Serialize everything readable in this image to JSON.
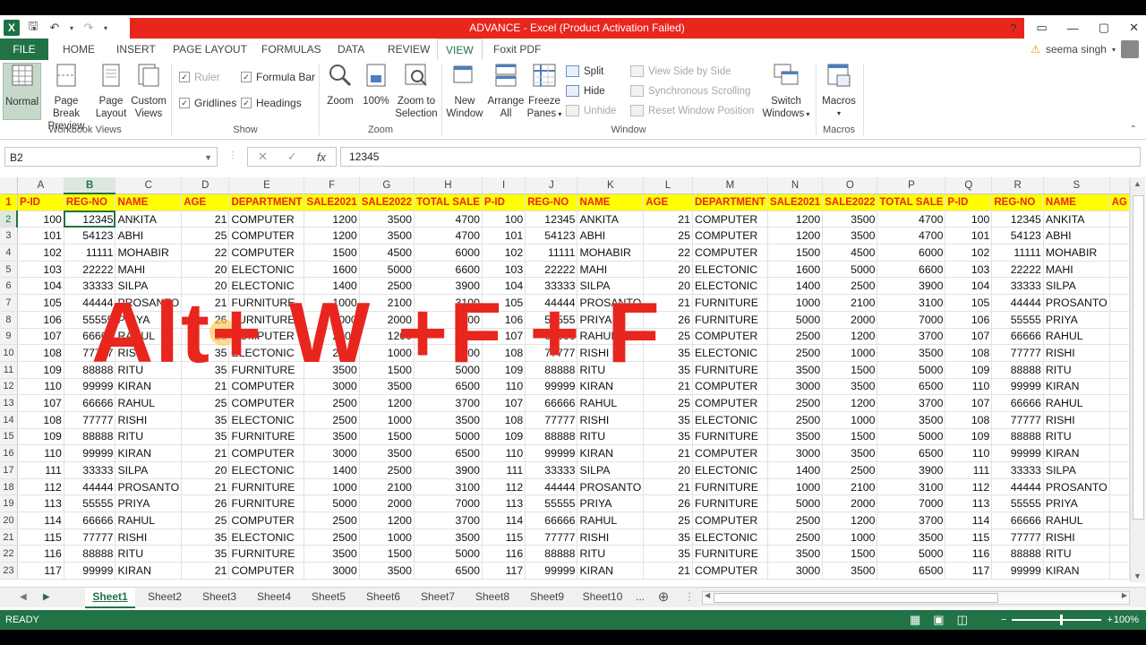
{
  "app": {
    "title": "ADVANCE - Excel (Product Activation Failed)",
    "logo_letter": "X",
    "user_name": "seema singh",
    "help": "?",
    "window_controls": [
      "▭",
      "—",
      "▢",
      "✕"
    ]
  },
  "qat": {
    "save_icon": "save-icon",
    "undo_icon": "undo-icon",
    "redo_icon": "redo-icon"
  },
  "tabs": [
    "FILE",
    "HOME",
    "INSERT",
    "PAGE LAYOUT",
    "FORMULAS",
    "DATA",
    "REVIEW",
    "VIEW",
    "Foxit PDF"
  ],
  "active_tab": "VIEW",
  "ribbon": {
    "workbook_views": {
      "label": "Workbook Views",
      "normal": "Normal",
      "page_break_1": "Page Break",
      "page_break_2": "Preview",
      "page_layout_1": "Page",
      "page_layout_2": "Layout",
      "custom_1": "Custom",
      "custom_2": "Views"
    },
    "show": {
      "label": "Show",
      "ruler": "Ruler",
      "formula_bar": "Formula Bar",
      "gridlines": "Gridlines",
      "headings": "Headings"
    },
    "zoom": {
      "label": "Zoom",
      "zoom": "Zoom",
      "hundred": "100%",
      "zoom_sel_1": "Zoom to",
      "zoom_sel_2": "Selection"
    },
    "window": {
      "label": "Window",
      "new_window_1": "New",
      "new_window_2": "Window",
      "arrange_1": "Arrange",
      "arrange_2": "All",
      "freeze_1": "Freeze",
      "freeze_2": "Panes",
      "split": "Split",
      "hide": "Hide",
      "unhide": "Unhide",
      "view_side": "View Side by Side",
      "sync_scroll": "Synchronous Scrolling",
      "reset_pos": "Reset Window Position",
      "switch_1": "Switch",
      "switch_2": "Windows"
    },
    "macros": {
      "label": "Macros",
      "macros": "Macros"
    }
  },
  "formula_bar": {
    "name_box": "B2",
    "cancel": "✕",
    "enter": "✓",
    "fx": "fx",
    "value": "12345"
  },
  "columns": [
    "A",
    "B",
    "C",
    "D",
    "E",
    "F",
    "G",
    "H",
    "I",
    "J",
    "K",
    "L",
    "M",
    "N",
    "O",
    "P",
    "Q",
    "R",
    "S",
    ""
  ],
  "selected_column": "B",
  "header_row": [
    "P-ID",
    "REG-NO",
    "NAME",
    "AGE",
    "DEPARTMENT",
    "SALE2021",
    "SALE2022",
    "TOTAL SALE",
    "P-ID",
    "REG-NO",
    "NAME",
    "AGE",
    "DEPARTMENT",
    "SALE2021",
    "SALE2022",
    "TOTAL SALE",
    "P-ID",
    "REG-NO",
    "NAME",
    "AG"
  ],
  "rows": [
    {
      "n": "2",
      "c": [
        "100",
        "12345",
        "ANKITA",
        "21",
        "COMPUTER",
        "1200",
        "3500",
        "4700",
        "100",
        "12345",
        "ANKITA",
        "21",
        "COMPUTER",
        "1200",
        "3500",
        "4700",
        "100",
        "12345",
        "ANKITA",
        ""
      ]
    },
    {
      "n": "3",
      "c": [
        "101",
        "54123",
        "ABHI",
        "25",
        "COMPUTER",
        "1200",
        "3500",
        "4700",
        "101",
        "54123",
        "ABHI",
        "25",
        "COMPUTER",
        "1200",
        "3500",
        "4700",
        "101",
        "54123",
        "ABHI",
        ""
      ]
    },
    {
      "n": "4",
      "c": [
        "102",
        "11111",
        "MOHABIR",
        "22",
        "COMPUTER",
        "1500",
        "4500",
        "6000",
        "102",
        "11111",
        "MOHABIR",
        "22",
        "COMPUTER",
        "1500",
        "4500",
        "6000",
        "102",
        "11111",
        "MOHABIR",
        ""
      ]
    },
    {
      "n": "5",
      "c": [
        "103",
        "22222",
        "MAHI",
        "20",
        "ELECTONIC",
        "1600",
        "5000",
        "6600",
        "103",
        "22222",
        "MAHI",
        "20",
        "ELECTONIC",
        "1600",
        "5000",
        "6600",
        "103",
        "22222",
        "MAHI",
        ""
      ]
    },
    {
      "n": "6",
      "c": [
        "104",
        "33333",
        "SILPA",
        "20",
        "ELECTONIC",
        "1400",
        "2500",
        "3900",
        "104",
        "33333",
        "SILPA",
        "20",
        "ELECTONIC",
        "1400",
        "2500",
        "3900",
        "104",
        "33333",
        "SILPA",
        ""
      ]
    },
    {
      "n": "7",
      "c": [
        "105",
        "44444",
        "PROSANTO",
        "21",
        "FURNITURE",
        "1000",
        "2100",
        "3100",
        "105",
        "44444",
        "PROSANTO",
        "21",
        "FURNITURE",
        "1000",
        "2100",
        "3100",
        "105",
        "44444",
        "PROSANTO",
        ""
      ]
    },
    {
      "n": "8",
      "c": [
        "106",
        "55555",
        "PRIYA",
        "26",
        "FURNITURE",
        "5000",
        "2000",
        "7000",
        "106",
        "55555",
        "PRIYA",
        "26",
        "FURNITURE",
        "5000",
        "2000",
        "7000",
        "106",
        "55555",
        "PRIYA",
        ""
      ]
    },
    {
      "n": "9",
      "c": [
        "107",
        "66666",
        "RAHUL",
        "25",
        "COMPUTER",
        "2500",
        "1200",
        "3700",
        "107",
        "66666",
        "RAHUL",
        "25",
        "COMPUTER",
        "2500",
        "1200",
        "3700",
        "107",
        "66666",
        "RAHUL",
        ""
      ]
    },
    {
      "n": "10",
      "c": [
        "108",
        "77777",
        "RISHI",
        "35",
        "ELECTONIC",
        "2500",
        "1000",
        "3500",
        "108",
        "77777",
        "RISHI",
        "35",
        "ELECTONIC",
        "2500",
        "1000",
        "3500",
        "108",
        "77777",
        "RISHI",
        ""
      ]
    },
    {
      "n": "11",
      "c": [
        "109",
        "88888",
        "RITU",
        "35",
        "FURNITURE",
        "3500",
        "1500",
        "5000",
        "109",
        "88888",
        "RITU",
        "35",
        "FURNITURE",
        "3500",
        "1500",
        "5000",
        "109",
        "88888",
        "RITU",
        ""
      ]
    },
    {
      "n": "12",
      "c": [
        "110",
        "99999",
        "KIRAN",
        "21",
        "COMPUTER",
        "3000",
        "3500",
        "6500",
        "110",
        "99999",
        "KIRAN",
        "21",
        "COMPUTER",
        "3000",
        "3500",
        "6500",
        "110",
        "99999",
        "KIRAN",
        ""
      ]
    },
    {
      "n": "13",
      "c": [
        "107",
        "66666",
        "RAHUL",
        "25",
        "COMPUTER",
        "2500",
        "1200",
        "3700",
        "107",
        "66666",
        "RAHUL",
        "25",
        "COMPUTER",
        "2500",
        "1200",
        "3700",
        "107",
        "66666",
        "RAHUL",
        ""
      ]
    },
    {
      "n": "14",
      "c": [
        "108",
        "77777",
        "RISHI",
        "35",
        "ELECTONIC",
        "2500",
        "1000",
        "3500",
        "108",
        "77777",
        "RISHI",
        "35",
        "ELECTONIC",
        "2500",
        "1000",
        "3500",
        "108",
        "77777",
        "RISHI",
        ""
      ]
    },
    {
      "n": "15",
      "c": [
        "109",
        "88888",
        "RITU",
        "35",
        "FURNITURE",
        "3500",
        "1500",
        "5000",
        "109",
        "88888",
        "RITU",
        "35",
        "FURNITURE",
        "3500",
        "1500",
        "5000",
        "109",
        "88888",
        "RITU",
        ""
      ]
    },
    {
      "n": "16",
      "c": [
        "110",
        "99999",
        "KIRAN",
        "21",
        "COMPUTER",
        "3000",
        "3500",
        "6500",
        "110",
        "99999",
        "KIRAN",
        "21",
        "COMPUTER",
        "3000",
        "3500",
        "6500",
        "110",
        "99999",
        "KIRAN",
        ""
      ]
    },
    {
      "n": "17",
      "c": [
        "111",
        "33333",
        "SILPA",
        "20",
        "ELECTONIC",
        "1400",
        "2500",
        "3900",
        "111",
        "33333",
        "SILPA",
        "20",
        "ELECTONIC",
        "1400",
        "2500",
        "3900",
        "111",
        "33333",
        "SILPA",
        ""
      ]
    },
    {
      "n": "18",
      "c": [
        "112",
        "44444",
        "PROSANTO",
        "21",
        "FURNITURE",
        "1000",
        "2100",
        "3100",
        "112",
        "44444",
        "PROSANTO",
        "21",
        "FURNITURE",
        "1000",
        "2100",
        "3100",
        "112",
        "44444",
        "PROSANTO",
        ""
      ]
    },
    {
      "n": "19",
      "c": [
        "113",
        "55555",
        "PRIYA",
        "26",
        "FURNITURE",
        "5000",
        "2000",
        "7000",
        "113",
        "55555",
        "PRIYA",
        "26",
        "FURNITURE",
        "5000",
        "2000",
        "7000",
        "113",
        "55555",
        "PRIYA",
        ""
      ]
    },
    {
      "n": "20",
      "c": [
        "114",
        "66666",
        "RAHUL",
        "25",
        "COMPUTER",
        "2500",
        "1200",
        "3700",
        "114",
        "66666",
        "RAHUL",
        "25",
        "COMPUTER",
        "2500",
        "1200",
        "3700",
        "114",
        "66666",
        "RAHUL",
        ""
      ]
    },
    {
      "n": "21",
      "c": [
        "115",
        "77777",
        "RISHI",
        "35",
        "ELECTONIC",
        "2500",
        "1000",
        "3500",
        "115",
        "77777",
        "RISHI",
        "35",
        "ELECTONIC",
        "2500",
        "1000",
        "3500",
        "115",
        "77777",
        "RISHI",
        ""
      ]
    },
    {
      "n": "22",
      "c": [
        "116",
        "88888",
        "RITU",
        "35",
        "FURNITURE",
        "3500",
        "1500",
        "5000",
        "116",
        "88888",
        "RITU",
        "35",
        "FURNITURE",
        "3500",
        "1500",
        "5000",
        "116",
        "88888",
        "RITU",
        ""
      ]
    },
    {
      "n": "23",
      "c": [
        "117",
        "99999",
        "KIRAN",
        "21",
        "COMPUTER",
        "3000",
        "3500",
        "6500",
        "117",
        "99999",
        "KIRAN",
        "21",
        "COMPUTER",
        "3000",
        "3500",
        "6500",
        "117",
        "99999",
        "KIRAN",
        ""
      ]
    }
  ],
  "numeric_columns": [
    0,
    1,
    3,
    5,
    6,
    7,
    8,
    9,
    11,
    13,
    14,
    15,
    16,
    17
  ],
  "overlay_text": "Alt+ W +F + F",
  "sheets": [
    "Sheet1",
    "Sheet2",
    "Sheet3",
    "Sheet4",
    "Sheet5",
    "Sheet6",
    "Sheet7",
    "Sheet8",
    "Sheet9",
    "Sheet10"
  ],
  "active_sheet": "Sheet1",
  "sheets_more": "...",
  "add_sheet": "⊕",
  "status": {
    "ready": "READY",
    "zoom": "100%",
    "zoom_out": "−",
    "zoom_in": "+"
  },
  "colors": {
    "excel_green": "#217346",
    "title_red": "#e8261e",
    "header_yellow": "#ffff00"
  }
}
